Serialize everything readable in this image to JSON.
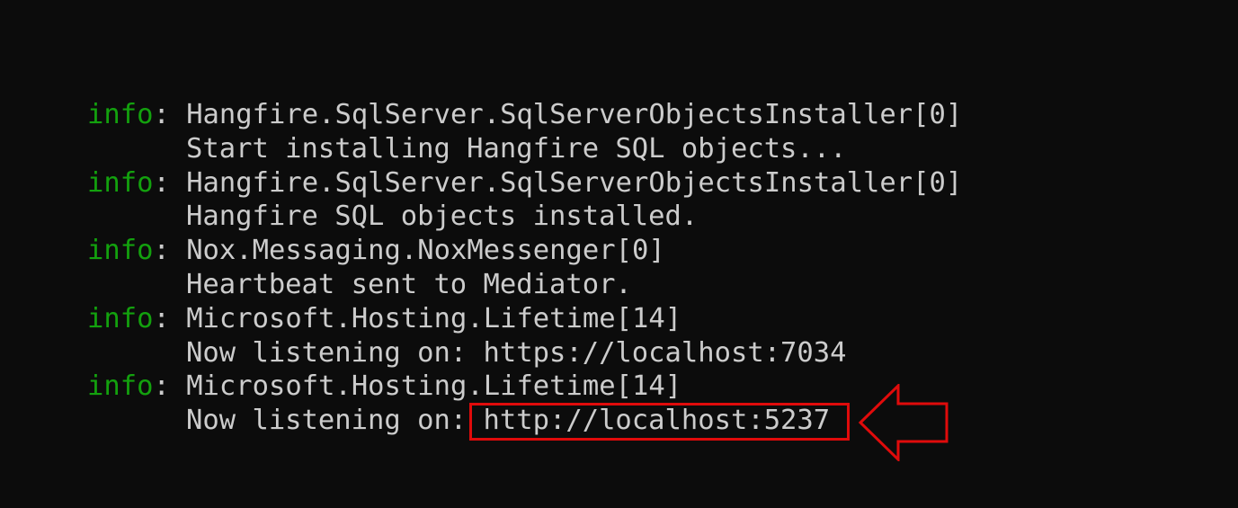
{
  "log": {
    "entries": [
      {
        "level": "info",
        "sep": ": ",
        "category": "Hangfire.SqlServer.SqlServerObjectsInstaller[0]",
        "message": "Start installing Hangfire SQL objects..."
      },
      {
        "level": "info",
        "sep": ": ",
        "category": "Hangfire.SqlServer.SqlServerObjectsInstaller[0]",
        "message": "Hangfire SQL objects installed."
      },
      {
        "level": "info",
        "sep": ": ",
        "category": "Nox.Messaging.NoxMessenger[0]",
        "message": "Heartbeat sent to Mediator."
      },
      {
        "level": "info",
        "sep": ": ",
        "category": "Microsoft.Hosting.Lifetime[14]",
        "message": "Now listening on: https://localhost:7034"
      },
      {
        "level": "info",
        "sep": ": ",
        "category": "Microsoft.Hosting.Lifetime[14]",
        "message_prefix": "Now listening on: ",
        "message_url": "http://localhost:5237"
      }
    ]
  },
  "colors": {
    "background": "#0c0c0c",
    "text": "#cccccc",
    "level_info": "#13a10e",
    "highlight": "#e00b0b"
  },
  "icons": {
    "callout": "left-arrow-outline-icon"
  }
}
